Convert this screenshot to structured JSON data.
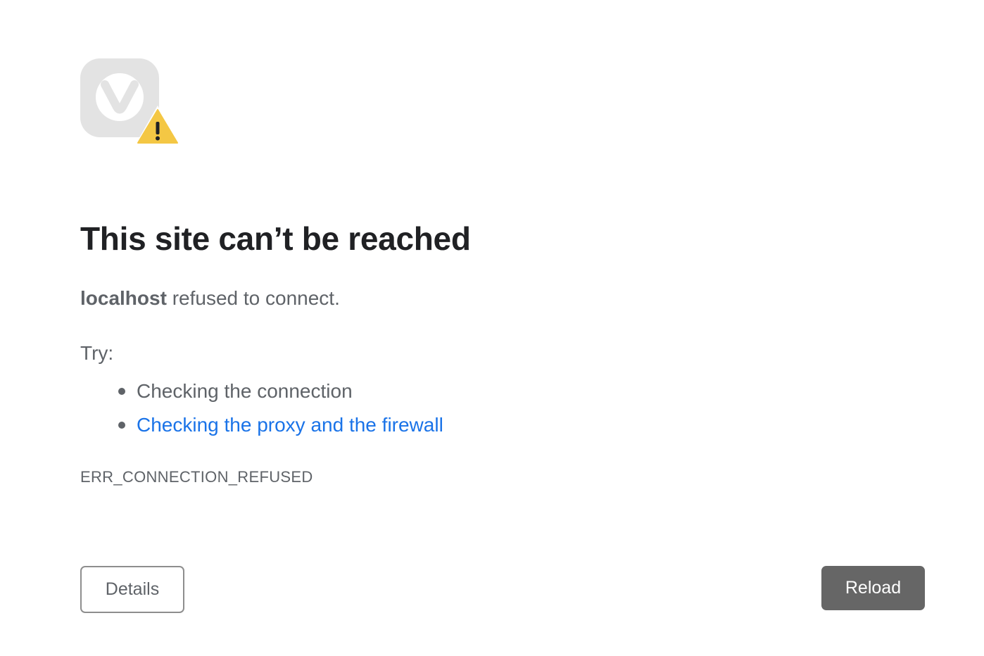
{
  "error_page": {
    "icon": "browser-logo-with-warning-icon",
    "title": "This site can’t be reached",
    "summary": {
      "host": "localhost",
      "message": " refused to connect."
    },
    "try_label": "Try:",
    "suggestions": [
      {
        "text": "Checking the connection",
        "is_link": false
      },
      {
        "text": "Checking the proxy and the firewall",
        "is_link": true
      }
    ],
    "error_code": "ERR_CONNECTION_REFUSED",
    "buttons": {
      "details": "Details",
      "reload": "Reload"
    }
  },
  "colors": {
    "title": "#202124",
    "body_text": "#5f6368",
    "link": "#1a73e8",
    "warning": "#f4c744",
    "logo_gray": "#e3e3e3",
    "reload_button": "#666666"
  }
}
